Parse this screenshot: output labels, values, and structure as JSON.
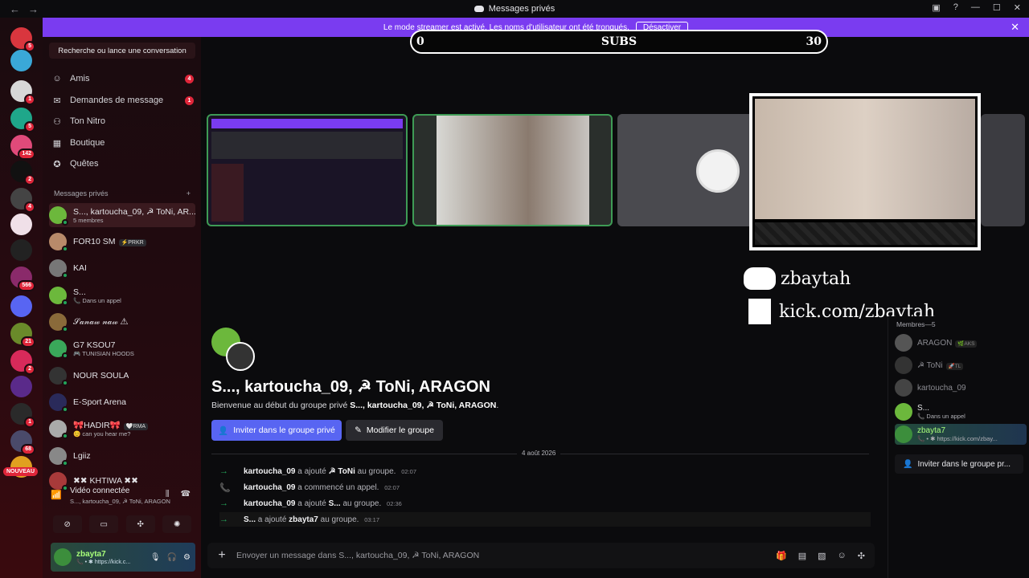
{
  "titlebar": {
    "title": "Messages privés",
    "back": "←",
    "forward": "→"
  },
  "banner": {
    "text": "Le mode streamer est activé. Les noms d'utilisateur ont été tronqués.",
    "action": "Désactiver",
    "close": "✕"
  },
  "rail": {
    "servers": [
      {
        "color": "#d9363e",
        "badge": "5"
      },
      {
        "color": "#3aa8d8",
        "badge": ""
      },
      {
        "color": "#d7d7d7",
        "badge": "1"
      },
      {
        "color": "#1fa78a",
        "badge": "5"
      },
      {
        "color": "#e04a7a",
        "badge": "142"
      },
      {
        "color": "#111111",
        "badge": "2"
      },
      {
        "color": "#444444",
        "badge": "4"
      },
      {
        "color": "#f0e0e8",
        "badge": ""
      },
      {
        "color": "#222222",
        "badge": ""
      },
      {
        "color": "#8a2a6a",
        "badge": "566"
      },
      {
        "color": "#5865f2",
        "badge": ""
      },
      {
        "color": "#6a8a2a",
        "badge": "21"
      },
      {
        "color": "#d82a5a",
        "badge": "2"
      },
      {
        "color": "#5a2a8a",
        "badge": ""
      },
      {
        "color": "#2a2a2a",
        "badge": "1"
      },
      {
        "color": "#4a4a6a",
        "badge": "68"
      },
      {
        "color": "#e0a020",
        "badge": ""
      }
    ],
    "nouveau": "NOUVEAU"
  },
  "sidebar": {
    "search": "Recherche ou lance une conversation",
    "nav": [
      {
        "label": "Amis",
        "icon": "friends-icon",
        "glyph": "☺",
        "badge": "4"
      },
      {
        "label": "Demandes de message",
        "icon": "mail-icon",
        "glyph": "✉",
        "badge": "1"
      },
      {
        "label": "Ton Nitro",
        "icon": "nitro-icon",
        "glyph": "⚇",
        "badge": ""
      },
      {
        "label": "Boutique",
        "icon": "shop-icon",
        "glyph": "▦",
        "badge": ""
      },
      {
        "label": "Quêtes",
        "icon": "quest-icon",
        "glyph": "✪",
        "badge": ""
      }
    ],
    "dm_header": "Messages privés",
    "dm_add": "+",
    "dms": [
      {
        "name": "S..., kartoucha_09, ☭ ToNi, AR...",
        "sub": "5 membres",
        "color": "#6cb83c",
        "tag": ""
      },
      {
        "name": "FOR10 SM",
        "sub": "",
        "color": "#b88a6a",
        "tag": "⚡PRKR"
      },
      {
        "name": "KAI",
        "sub": "",
        "color": "#777777",
        "tag": ""
      },
      {
        "name": "S...",
        "sub": "📞 Dans un appel",
        "color": "#6cb83c",
        "tag": ""
      },
      {
        "name": "𝒮𝒶𝓃𝒶𝓌 𝓃𝒶𝓌 ⚠",
        "sub": "",
        "color": "#8a6a3a",
        "tag": ""
      },
      {
        "name": "G7 KSOU7",
        "sub": "🎮 TUNISIAN HOODS",
        "color": "#3aa85a",
        "tag": ""
      },
      {
        "name": "NOUR SOULA",
        "sub": "",
        "color": "#333333",
        "tag": ""
      },
      {
        "name": "E-Sport Arena",
        "sub": "",
        "color": "#2a2a5a",
        "tag": ""
      },
      {
        "name": "🎀HADIR🎀",
        "sub": "😊 can you hear me?",
        "color": "#aaaaaa",
        "tag": "🤍RMA"
      },
      {
        "name": "Lgiiz",
        "sub": "",
        "color": "#888888",
        "tag": ""
      },
      {
        "name": "✖✖ KHTIWA ✖✖",
        "sub": "",
        "color": "#a83a3a",
        "tag": ""
      }
    ],
    "voice": {
      "title": "Vidéo connectée",
      "sub": "S..., kartoucha_09, ☭ ToNi, ARAGON"
    },
    "user": {
      "name": "zbayta7",
      "status": "📞 • ✱ https://kick.c..."
    }
  },
  "main": {
    "progress": {
      "low": "0",
      "label": "SUBS",
      "high": "30"
    },
    "overlay": {
      "discord": "zbaytah",
      "kick": "kick.com/zbaytah"
    },
    "group": {
      "title": "S..., kartoucha_09, ☭ ToNi, ARAGON",
      "welcome_prefix": "Bienvenue au début du groupe privé",
      "welcome_names": "S..., kartoucha_09, ☭ ToNi, ARAGON",
      "welcome_end": ".",
      "invite": "Inviter dans le groupe privé",
      "edit": "Modifier le groupe"
    },
    "date": "4 août 2026",
    "messages": [
      {
        "icon": "→",
        "actor": "kartoucha_09",
        "verb": "a ajouté",
        "target": "☭ ToNi",
        "rest": "au groupe.",
        "time": "02:07"
      },
      {
        "icon": "📞",
        "actor": "kartoucha_09",
        "verb": "a commencé un appel.",
        "target": "",
        "rest": "",
        "time": "02:07"
      },
      {
        "icon": "→",
        "actor": "kartoucha_09",
        "verb": "a ajouté",
        "target": "S...",
        "rest": "au groupe.",
        "time": "02:36"
      },
      {
        "icon": "→",
        "actor": "S...",
        "verb": "a ajouté",
        "target": "zbayta7",
        "rest": "au groupe.",
        "time": "03:17"
      }
    ],
    "composer_placeholder": "Envoyer un message dans S..., kartoucha_09, ☭ ToNi, ARAGON"
  },
  "members": {
    "header": "Membres—5",
    "list": [
      {
        "name": "ARAGON",
        "sub": "",
        "tag": "🌿AKS",
        "color": "#555555"
      },
      {
        "name": "☭ ToNi",
        "sub": "",
        "tag": "🚀TL",
        "color": "#333333"
      },
      {
        "name": "kartoucha_09",
        "sub": "",
        "tag": "",
        "color": "#444444"
      },
      {
        "name": "S...",
        "sub": "📞 Dans un appel",
        "tag": "",
        "color": "#6cb83c"
      },
      {
        "name": "zbayta7",
        "sub": "📞 • ✱ https://kick.com/zbay...",
        "tag": "",
        "color": "#3c8e3c"
      }
    ],
    "invite": "Inviter dans le groupe pr..."
  }
}
